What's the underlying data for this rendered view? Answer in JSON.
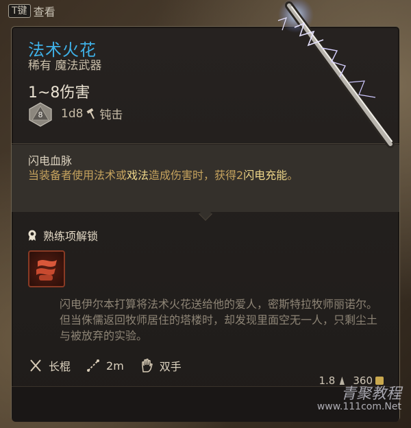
{
  "hint": {
    "key": "T键",
    "label": "查看"
  },
  "item": {
    "name": "法术火花",
    "rarity_type": "稀有 魔法武器",
    "damage": "1~8伤害",
    "dice_face": "8",
    "dice_formula": "1d8",
    "damage_type": "钝击"
  },
  "passive": {
    "name": "闪电血脉",
    "desc_part1": "当装备者使用法术或",
    "desc_hl1": "戏法",
    "desc_part2": "造成伤害时，获得2",
    "desc_hl2": "闪电充能",
    "desc_part3": "。"
  },
  "proficiency": {
    "label": "熟练项解锁"
  },
  "lore": "闪电伊尔本打算将法术火花送给他的爱人，密斯特拉牧师丽诺尔。但当侏儒返回牧师居住的塔楼时，却发现里面空无一人，只剩尘土与被放弃的实验。",
  "properties": {
    "weapon_type": "长棍",
    "range": "2m",
    "handedness": "双手"
  },
  "stats": {
    "weight": "1.8",
    "value": "360"
  },
  "watermark": {
    "brand": "青聚教程",
    "url": "www.111com.Net"
  },
  "colors": {
    "title": "#3fb0e6",
    "passive_text": "#c6a35e",
    "highlight": "#f0d88a",
    "lore_text": "#8e8576"
  }
}
